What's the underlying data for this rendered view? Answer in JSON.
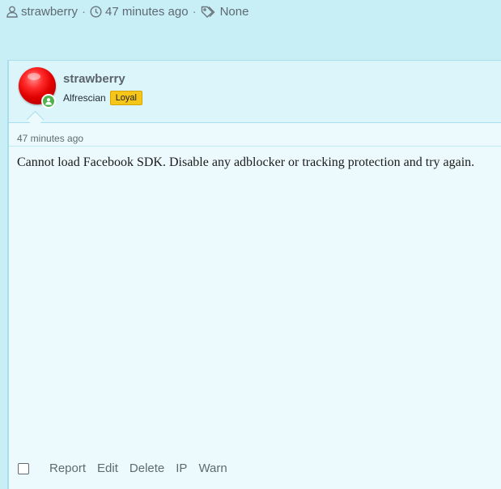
{
  "topmeta": {
    "author": "strawberry",
    "time": "47 minutes ago",
    "tags": "None",
    "separator": "·"
  },
  "post": {
    "username": "strawberry",
    "user_title": "Alfrescian",
    "badge": "Loyal",
    "date": "47 minutes ago",
    "message": "Cannot load Facebook SDK. Disable any adblocker or tracking protection and try again.",
    "actions": [
      "Report",
      "Edit",
      "Delete",
      "IP",
      "Warn"
    ]
  },
  "colors": {
    "background": "#c8eef6",
    "post_bg": "#ecfafd",
    "userbar_bg": "#dcf5fb",
    "badge": "#f5c518",
    "online": "#4fb24d"
  }
}
